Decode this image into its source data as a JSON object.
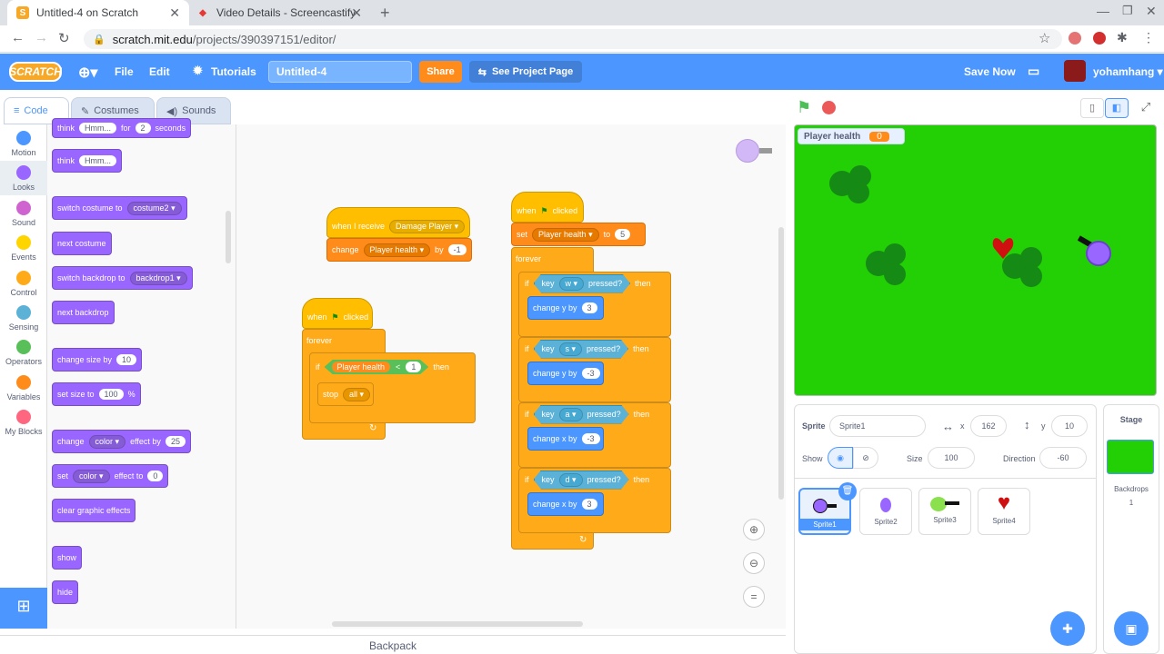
{
  "browser": {
    "tabs": [
      {
        "title": "Untitled-4 on Scratch"
      },
      {
        "title": "Video Details - Screencastify"
      }
    ],
    "url_host": "scratch.mit.edu",
    "url_path": "/projects/390397151/editor/"
  },
  "menu": {
    "logo": "SCRATCH",
    "file": "File",
    "edit": "Edit",
    "tutorials": "Tutorials",
    "project_title": "Untitled-4",
    "share": "Share",
    "see_project": "See Project Page",
    "save_now": "Save Now",
    "username": "yohamhang"
  },
  "editor_tabs": [
    "Code",
    "Costumes",
    "Sounds"
  ],
  "categories": [
    {
      "label": "Motion",
      "color": "#4c97ff"
    },
    {
      "label": "Looks",
      "color": "#9966ff"
    },
    {
      "label": "Sound",
      "color": "#cf63cf"
    },
    {
      "label": "Events",
      "color": "#ffd500"
    },
    {
      "label": "Control",
      "color": "#ffab19"
    },
    {
      "label": "Sensing",
      "color": "#5cb1d6"
    },
    {
      "label": "Operators",
      "color": "#59c059"
    },
    {
      "label": "Variables",
      "color": "#ff8c1a"
    },
    {
      "label": "My Blocks",
      "color": "#ff6680"
    }
  ],
  "palette": {
    "think_for": {
      "a": "think",
      "b": "Hmm...",
      "c": "for",
      "d": "2",
      "e": "seconds"
    },
    "think": {
      "a": "think",
      "b": "Hmm..."
    },
    "switch_costume": {
      "a": "switch costume to",
      "b": "costume2"
    },
    "next_costume": "next costume",
    "switch_backdrop": {
      "a": "switch backdrop to",
      "b": "backdrop1"
    },
    "next_backdrop": "next backdrop",
    "change_size": {
      "a": "change size by",
      "b": "10"
    },
    "set_size": {
      "a": "set size to",
      "b": "100",
      "c": "%"
    },
    "change_effect": {
      "a": "change",
      "b": "color",
      "c": "effect by",
      "d": "25"
    },
    "set_effect": {
      "a": "set",
      "b": "color",
      "c": "effect to",
      "d": "0"
    },
    "clear_effects": "clear graphic effects",
    "show": "show",
    "hide": "hide"
  },
  "scripts": {
    "receive": {
      "when": "when I receive",
      "msg": "Damage Player",
      "change": "change",
      "var": "Player health",
      "by": "by",
      "val": "-1"
    },
    "check": {
      "when": "when",
      "clicked": "clicked",
      "forever": "forever",
      "if": "if",
      "var": "Player health",
      "lt": "<",
      "val": "1",
      "then": "then",
      "stop": "stop",
      "all": "all"
    },
    "move": {
      "when": "when",
      "clicked": "clicked",
      "set": "set",
      "var": "Player health",
      "to": "to",
      "val": "5",
      "forever": "forever",
      "ifs": [
        {
          "if": "if",
          "key": "key",
          "k": "w",
          "pressed": "pressed?",
          "then": "then",
          "act": "change y by",
          "v": "3"
        },
        {
          "if": "if",
          "key": "key",
          "k": "s",
          "pressed": "pressed?",
          "then": "then",
          "act": "change y by",
          "v": "-3"
        },
        {
          "if": "if",
          "key": "key",
          "k": "a",
          "pressed": "pressed?",
          "then": "then",
          "act": "change x by",
          "v": "-3"
        },
        {
          "if": "if",
          "key": "key",
          "k": "d",
          "pressed": "pressed?",
          "then": "then",
          "act": "change x by",
          "v": "3"
        }
      ]
    }
  },
  "stage": {
    "monitor_label": "Player health",
    "monitor_value": "0"
  },
  "sprite_info": {
    "sprite_label": "Sprite",
    "sprite_name": "Sprite1",
    "x_label": "x",
    "x": "162",
    "y_label": "y",
    "y": "10",
    "show_label": "Show",
    "size_label": "Size",
    "size": "100",
    "direction_label": "Direction",
    "direction": "-60"
  },
  "sprites": [
    "Sprite1",
    "Sprite2",
    "Sprite3",
    "Sprite4"
  ],
  "stage_panel": {
    "title": "Stage",
    "backdrops_label": "Backdrops",
    "backdrops_count": "1"
  },
  "backpack": "Backpack",
  "colors": {
    "scratch_blue": "#4c97ff",
    "stage_green": "#22d005",
    "share_orange": "#ff8c1a"
  }
}
